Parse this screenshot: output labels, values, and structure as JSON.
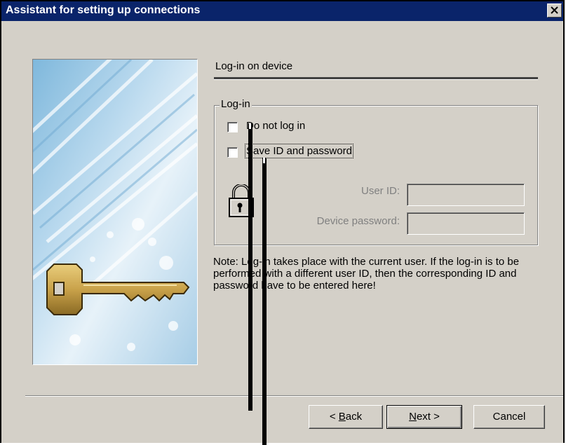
{
  "window": {
    "title": "Assistant for setting up connections"
  },
  "page": {
    "heading": "Log-in on device"
  },
  "login_group": {
    "legend": "Log-in",
    "do_not_log_in": {
      "label": "Do not log in",
      "checked": false
    },
    "save_id_password": {
      "label": "Save ID and password",
      "checked": false
    }
  },
  "fields": {
    "user_id": {
      "label": "User ID:",
      "value": ""
    },
    "device_password": {
      "label": "Device password:",
      "value": ""
    }
  },
  "note": "Note: Log-in takes place with the current user. If the log-in is to be performed with a different user ID, then the corresponding ID and password have to be entered here!",
  "buttons": {
    "back": {
      "prefix": "< ",
      "mnemonic": "B",
      "rest": "ack"
    },
    "next": {
      "mnemonic": "N",
      "rest": "ext >"
    },
    "cancel": "Cancel"
  },
  "icons": {
    "close": "close-icon",
    "lock": "padlock-icon",
    "key": "key-icon"
  },
  "colors": {
    "titlebar": "#0a246a",
    "dialog_bg": "#d4d0c8",
    "key_gold": "#c9a24a"
  }
}
